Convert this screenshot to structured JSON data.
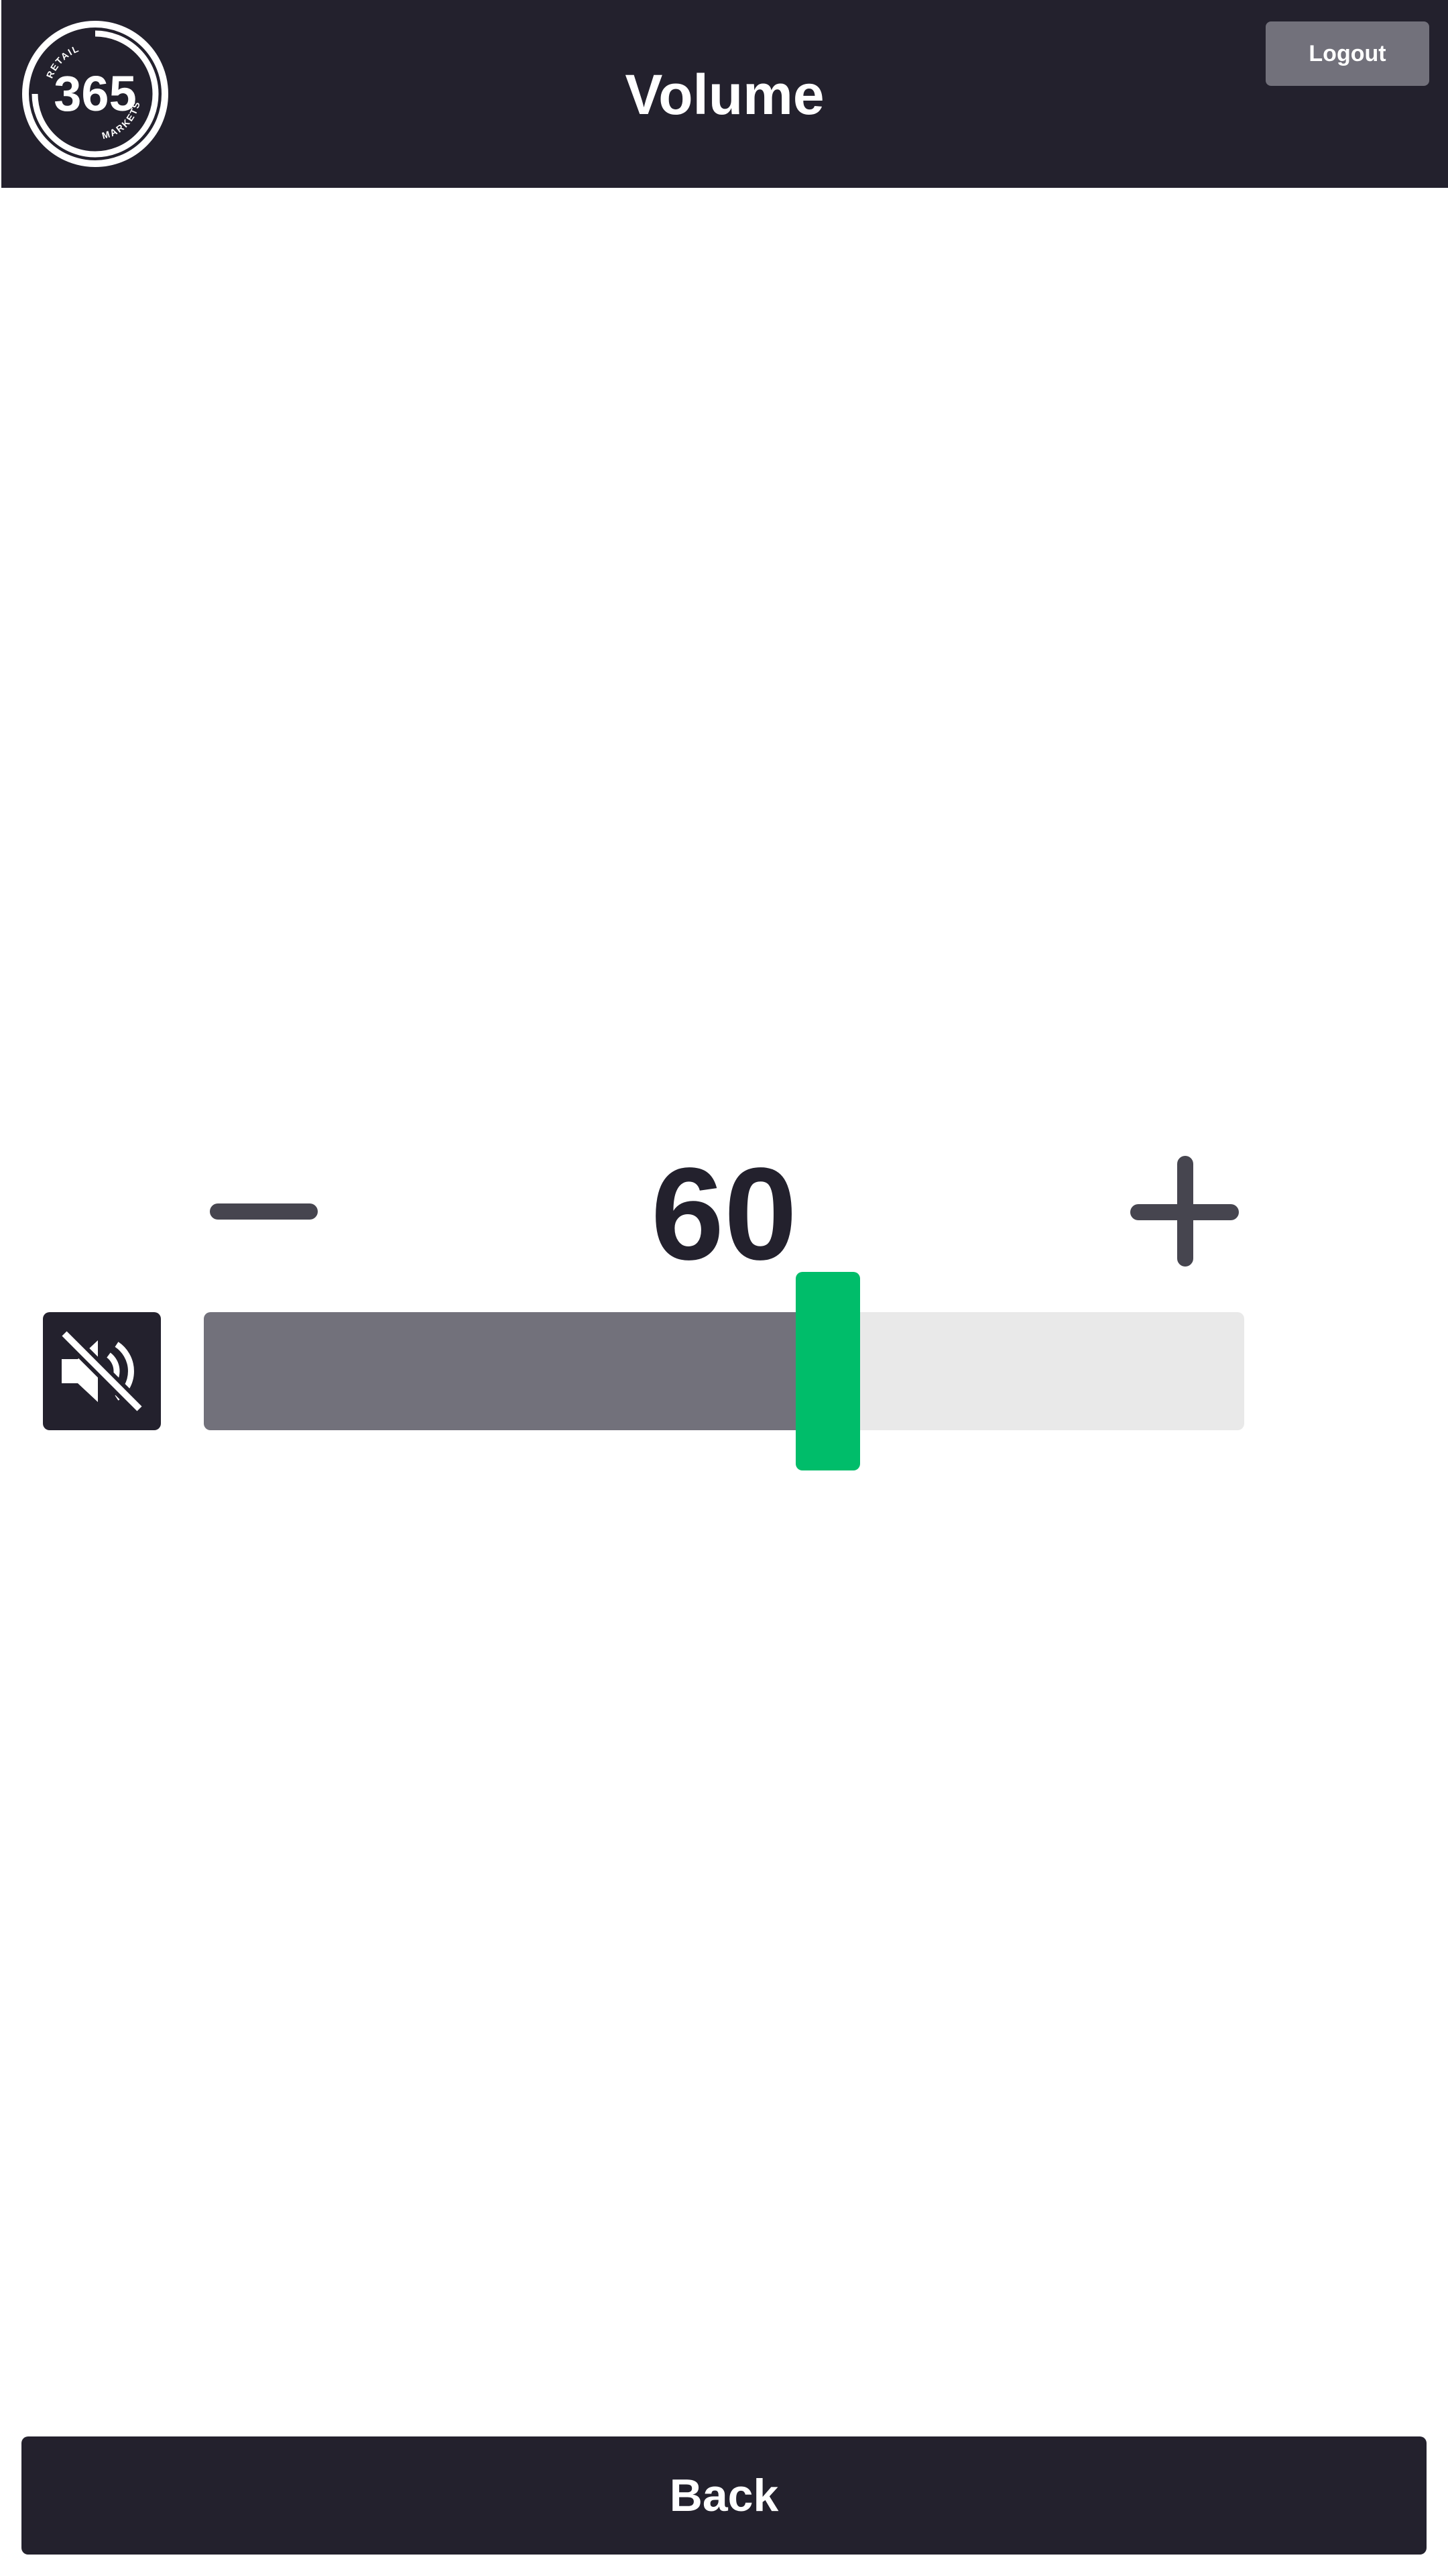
{
  "header": {
    "title": "Volume",
    "logout_label": "Logout",
    "logo": {
      "number": "365",
      "top_text": "RETAIL",
      "bottom_text": "MARKETS"
    }
  },
  "volume": {
    "value": "60",
    "level_fraction": 0.6,
    "decrease_icon": "minus-icon",
    "increase_icon": "plus-icon",
    "mute_icon": "volume-mute-icon"
  },
  "footer": {
    "back_label": "Back"
  },
  "colors": {
    "header_bg": "#23212d",
    "button_gray": "#72717b",
    "track_bg": "#e9e9e9",
    "thumb_green": "#00bd6a",
    "icon_gray": "#46454f"
  }
}
